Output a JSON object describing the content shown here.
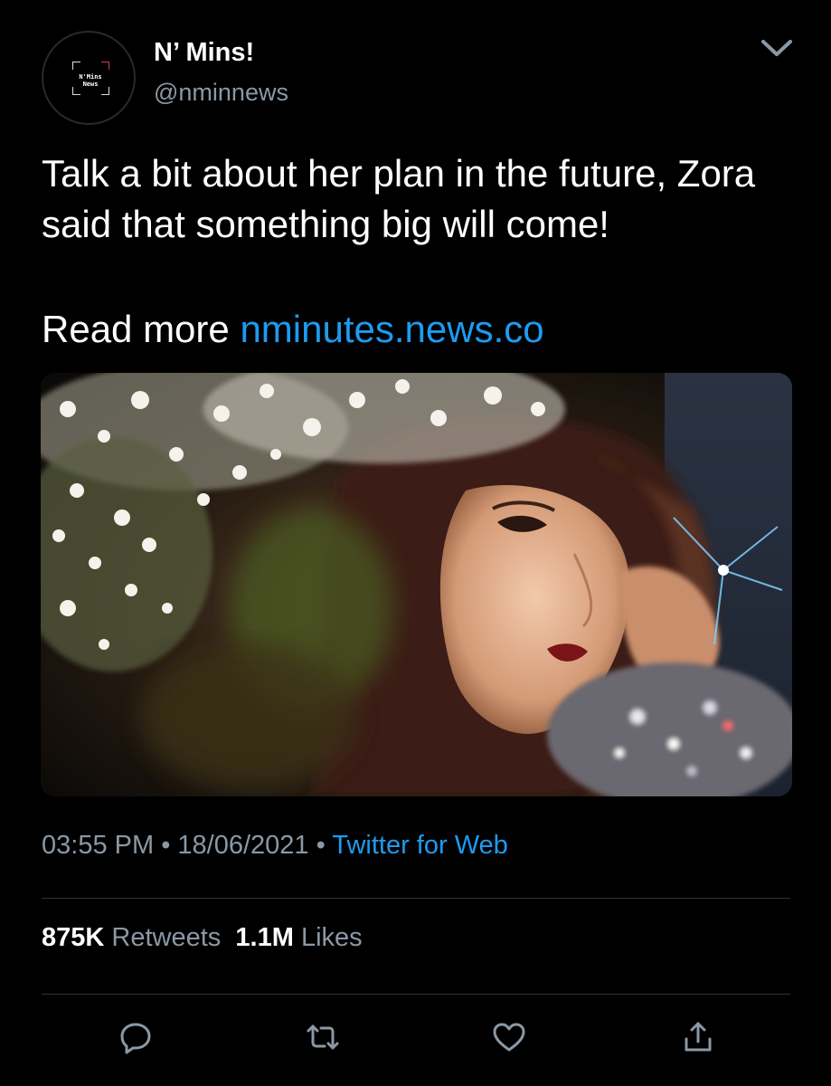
{
  "author": {
    "display_name": "N’ Mins!",
    "handle": "@nminnews",
    "avatar_text": "N'Mins News"
  },
  "tweet": {
    "text": "Talk a bit about her plan in the future, Zora said that something big will come!",
    "read_more_label": "Read more ",
    "link_text": "nminutes.news.co"
  },
  "meta": {
    "time": "03:55 PM",
    "separator": "•",
    "date": "18/06/2021",
    "source": "Twitter for Web"
  },
  "stats": {
    "retweets_count": "875K",
    "retweets_label": "Retweets",
    "likes_count": "1.1M",
    "likes_label": "Likes"
  },
  "icons": {
    "menu": "chevron-down-icon",
    "reply": "reply-icon",
    "retweet": "retweet-icon",
    "like": "heart-icon",
    "share": "share-icon"
  },
  "colors": {
    "background": "#000000",
    "text": "#ffffff",
    "secondary": "#8b98a5",
    "link": "#1d9bf0",
    "divider": "#2f3336"
  }
}
